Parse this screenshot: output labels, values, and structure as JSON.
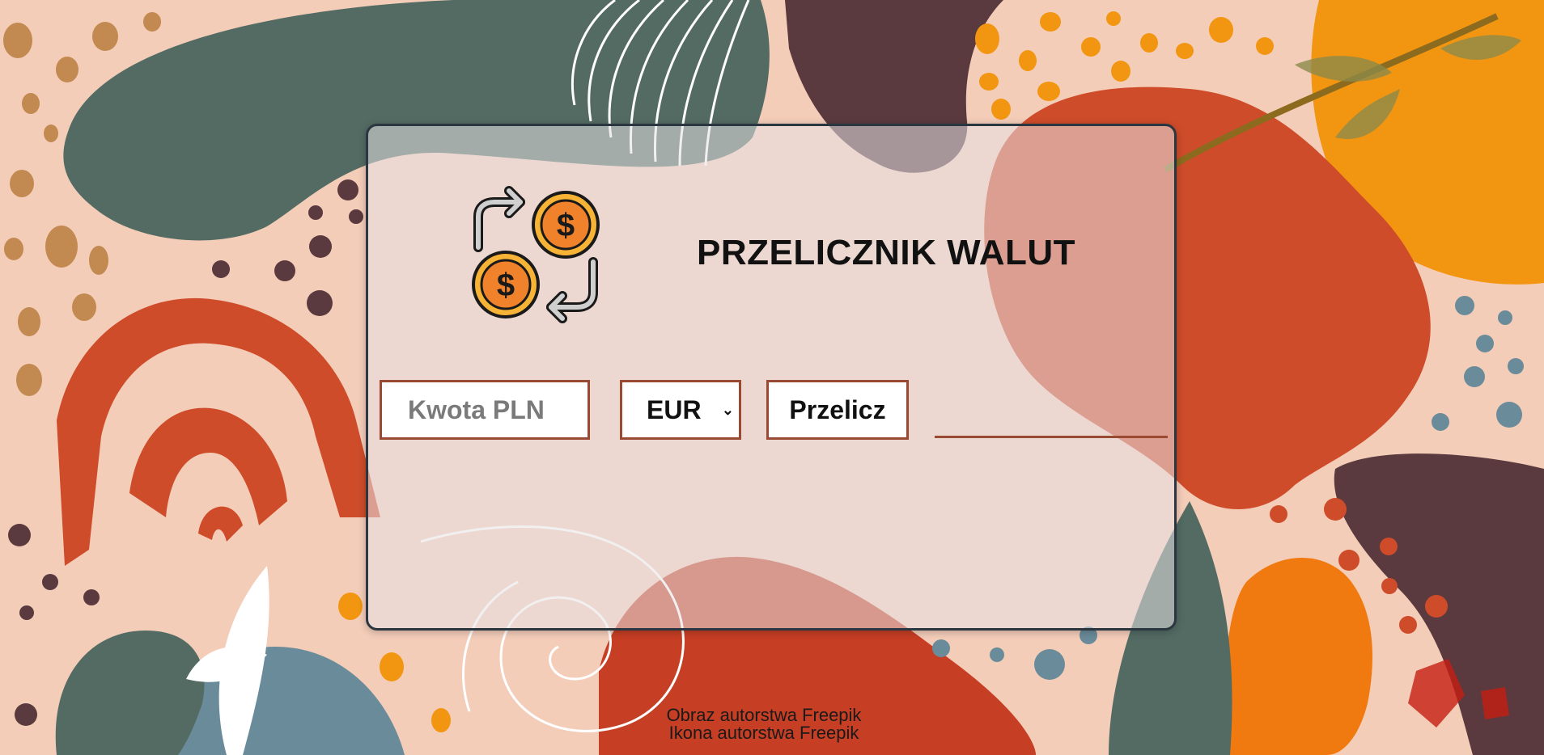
{
  "app": {
    "title": "PRZELICZNIK WALUT"
  },
  "icons": {
    "logo": "currency-exchange-icon",
    "chevron": "chevron-down-icon"
  },
  "form": {
    "amount_value": "",
    "amount_placeholder": "Kwota PLN",
    "currency_selected": "EUR",
    "convert_label": "Przelicz",
    "result_value": ""
  },
  "credits": {
    "image_credit": "Obraz autorstwa Freepik",
    "icon_credit": "Ikona autorstwa Freepik"
  },
  "colors": {
    "background": "#f4cdb9",
    "card_border": "#2b3740",
    "field_border": "#9a4a33",
    "coin_fill": "#f0822c",
    "coin_ring": "#f7b336"
  }
}
